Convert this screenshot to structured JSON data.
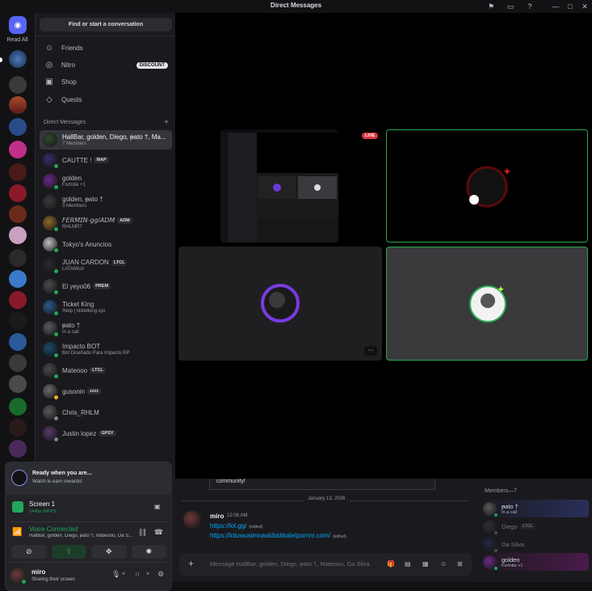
{
  "window": {
    "title": "Direct Messages"
  },
  "rail": {
    "read_all": "Read All"
  },
  "sidebar": {
    "search_label": "Find or start a conversation",
    "nav": [
      {
        "label": "Friends",
        "icon": "friends-icon"
      },
      {
        "label": "Nitro",
        "icon": "nitro-icon",
        "badge": "DISCOUNT"
      },
      {
        "label": "Shop",
        "icon": "shop-icon"
      },
      {
        "label": "Quests",
        "icon": "quests-icon"
      }
    ],
    "dm_header": "Direct Messages",
    "dms": [
      {
        "name": "HallBar, golden, Diego, ᵽato †, Ma...",
        "sub": "7 Members",
        "active": true,
        "color": "#2e4a2e"
      },
      {
        "name": "CAUTTE !",
        "tag": "MAP",
        "sub": "",
        "color": "#3a2b6a",
        "status": "#23a55a"
      },
      {
        "name": "golden",
        "sub": "Fortnite +1",
        "color": "#6a2a8a",
        "status": "#23a55a"
      },
      {
        "name": "golden, ᵽato †",
        "sub": "3 Members",
        "color": "#3a3a3a"
      },
      {
        "name": "𝘍𝘌𝘙𝘔𝘐𝘕·𝘨𝘨/𝘈𝘋𝘔",
        "tag": "ADM",
        "sub": "RHLMRT",
        "color": "#8a6a2a",
        "status": "#23a55a"
      },
      {
        "name": "Tokyo's Anuncios",
        "sub": "",
        "color": "#c0c0c0",
        "status": "#23a55a"
      },
      {
        "name": "JUAN CARDON",
        "tag": "LTCL",
        "sub": "LATAMcol",
        "color": "#2a2a2a",
        "status": "#23a55a"
      },
      {
        "name": "El yeyo06",
        "tag": "PREM",
        "sub": "",
        "color": "#4a4a4a",
        "status": "#23a55a"
      },
      {
        "name": "Ticket King",
        "sub": "/help | ticketking.xyz",
        "color": "#2a5a8a",
        "status": "#23a55a"
      },
      {
        "name": "ᵽato †",
        "sub": "In a call",
        "color": "#5a5a5a",
        "status": "#23a55a"
      },
      {
        "name": "Impacto BOT",
        "sub": "Bot Diseñado Para Impacto RP",
        "color": "#1a4a6a",
        "status": "#23a55a"
      },
      {
        "name": "Mateooo",
        "tag": "LTCL",
        "sub": "",
        "color": "#4a4a4a",
        "status": "#23a55a"
      },
      {
        "name": "gusonin",
        "tag": "zzzz",
        "sub": "",
        "color": "#6a6a6a",
        "status": "#f0b232"
      },
      {
        "name": "Chris_RHLM",
        "sub": "",
        "color": "#5a5a5a",
        "status": "#80848e"
      },
      {
        "name": "Justin lopez",
        "tag": "GPSY",
        "sub": "",
        "color": "#5a3a6a",
        "status": "#80848e"
      }
    ]
  },
  "panel": {
    "ready_title": "Ready when you are...",
    "ready_sub": "Watch to earn rewards!",
    "screen_title": "Screen 1",
    "screen_sub": "1440p 60FPS",
    "voice_title": "Voice Connected",
    "voice_sub": "HallBar, golden, Diego, ᵽato †, Mateooo, Da S...",
    "user_name": "miro",
    "user_status": "Sharing their screen"
  },
  "call": {
    "live_label": "LIVE",
    "more_label": "···"
  },
  "chat": {
    "quote_text": "community!",
    "date": "January 13, 2026",
    "message": {
      "author": "miro",
      "time": "12:06 AM",
      "line1": "https://lol.gg/",
      "line1_edited": "(edited)",
      "line2": "https://loluwusimnaskibiditoiletpornni.com/",
      "line2_edited": "(edited)"
    },
    "composer_placeholder": "Message HallBar, golden, Diego, ᵽato †, Mateooo, Da Silva"
  },
  "members": {
    "header": "Members—7",
    "list": [
      {
        "name": "ᵽato †",
        "sub": "In a call",
        "color": "#5a5a5a",
        "status": "#23a55a",
        "bg": "#2a2f5a"
      },
      {
        "name": "Diego",
        "tag": "LTCL",
        "sub": "",
        "color": "#4a4a4a",
        "status": "#80848e",
        "dim": true
      },
      {
        "name": "Da Silva",
        "sub": "",
        "color": "#2a3a6a",
        "status": "#80848e",
        "dim": true
      },
      {
        "name": "golden",
        "sub": "Fortnite +1",
        "color": "#6a2a8a",
        "status": "#23a55a",
        "bg": "#4a1a4a"
      }
    ]
  },
  "colors": {
    "accent": "#5865f2",
    "online": "#23a55a",
    "speaking": "#2aa84f",
    "link": "#00a8fc",
    "live": "#da373c"
  }
}
